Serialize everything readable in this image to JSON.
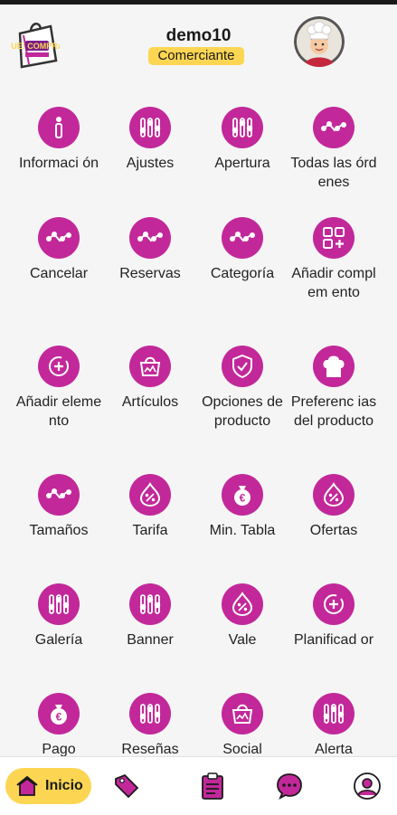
{
  "header": {
    "username": "demo10",
    "role": "Comerciante",
    "logo_text": "QUE! COMPRAR"
  },
  "colors": {
    "accent": "#c2289a",
    "badge": "#fcd653",
    "background": "#f5f5f5"
  },
  "menu": [
    {
      "label": "Informaci ón",
      "icon": "info-icon"
    },
    {
      "label": "Ajustes",
      "icon": "sliders-icon"
    },
    {
      "label": "Apertura",
      "icon": "sliders-icon"
    },
    {
      "label": "Todas las órdenes",
      "icon": "route-icon"
    },
    {
      "label": "Cancelar",
      "icon": "route-icon"
    },
    {
      "label": "Reservas",
      "icon": "route-icon"
    },
    {
      "label": "Categoría",
      "icon": "route-icon"
    },
    {
      "label": "Añadir complem ento",
      "icon": "add-widget-icon"
    },
    {
      "label": "Añadir elemento",
      "icon": "add-circle-icon"
    },
    {
      "label": "Artículos",
      "icon": "shopping-bag-icon"
    },
    {
      "label": "Opciones de producto",
      "icon": "shield-check-icon"
    },
    {
      "label": "Preferenc ias del producto",
      "icon": "chef-hat-icon"
    },
    {
      "label": "Tamaños",
      "icon": "route-icon"
    },
    {
      "label": "Tarifa",
      "icon": "discount-drop-icon"
    },
    {
      "label": "Min. Tabla",
      "icon": "money-bag-icon"
    },
    {
      "label": "Ofertas",
      "icon": "discount-drop-icon"
    },
    {
      "label": "Galería",
      "icon": "sliders-icon"
    },
    {
      "label": "Banner",
      "icon": "sliders-icon"
    },
    {
      "label": "Vale",
      "icon": "discount-drop-icon"
    },
    {
      "label": "Planificad or",
      "icon": "add-circle-icon"
    },
    {
      "label": "Pago",
      "icon": "money-bag-icon"
    },
    {
      "label": "Reseñas",
      "icon": "sliders-icon"
    },
    {
      "label": "Social",
      "icon": "shopping-bag-icon"
    },
    {
      "label": "Alerta",
      "icon": "sliders-icon"
    }
  ],
  "nav": {
    "home": "Inicio",
    "items": [
      "tag-icon",
      "clipboard-icon",
      "chat-icon",
      "profile-icon"
    ]
  }
}
